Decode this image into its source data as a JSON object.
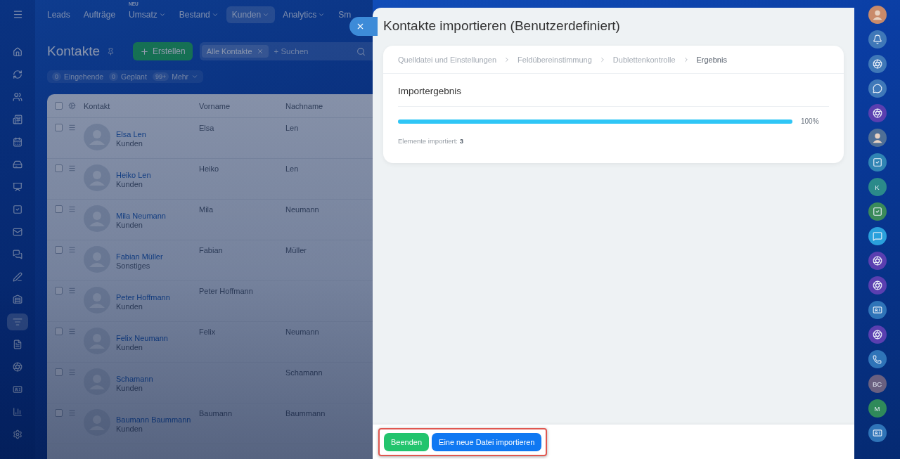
{
  "left_rail": {
    "menu": true,
    "items": [
      {
        "kind": "home",
        "selected": false
      },
      {
        "kind": "loop",
        "selected": false
      },
      {
        "kind": "users",
        "selected": false
      },
      {
        "kind": "news",
        "selected": false
      },
      {
        "kind": "calendar",
        "selected": false
      },
      {
        "kind": "storage",
        "selected": false
      },
      {
        "kind": "board",
        "selected": false
      },
      {
        "kind": "task",
        "selected": false
      },
      {
        "kind": "mail",
        "selected": false
      },
      {
        "kind": "chats",
        "selected": false
      },
      {
        "kind": "pen",
        "selected": false
      },
      {
        "kind": "warehouse",
        "selected": false
      },
      {
        "kind": "filter",
        "selected": true
      },
      {
        "kind": "file",
        "selected": false
      },
      {
        "kind": "aperture",
        "selected": false
      },
      {
        "kind": "card",
        "selected": false
      },
      {
        "kind": "chart",
        "selected": false
      },
      {
        "kind": "settings",
        "selected": false
      }
    ]
  },
  "top_nav": [
    {
      "label": "Leads",
      "selected": false,
      "has_menu": false
    },
    {
      "label": "Aufträge",
      "selected": false,
      "has_menu": false
    },
    {
      "label": "Umsatz",
      "badge": "NEU",
      "selected": false,
      "has_menu": true
    },
    {
      "label": "Bestand",
      "selected": false,
      "has_menu": true
    },
    {
      "label": "Kunden",
      "selected": true,
      "has_menu": true
    },
    {
      "label": "Analytics",
      "selected": false,
      "has_menu": true
    },
    {
      "label": "Sm",
      "selected": false,
      "has_menu": false
    }
  ],
  "page": {
    "title": "Kontakte",
    "create_button": "Erstellen",
    "search": {
      "chip": "Alle Kontakte",
      "placeholder": "+ Suchen"
    },
    "counters": [
      {
        "count": "0",
        "label": "Eingehende",
        "has_menu": false
      },
      {
        "count": "0",
        "label": "Geplant",
        "has_menu": false
      },
      {
        "count": "99+",
        "label": "Mehr",
        "has_menu": true
      }
    ]
  },
  "table": {
    "all_checked": false,
    "columns": [
      "Kontakt",
      "Vorname",
      "Nachname"
    ],
    "rows": [
      {
        "checked": false,
        "name": "Elsa Len",
        "type": "Kunden",
        "first": "Elsa",
        "last": "Len"
      },
      {
        "checked": false,
        "name": "Heiko Len",
        "type": "Kunden",
        "first": "Heiko",
        "last": "Len"
      },
      {
        "checked": false,
        "name": "Mila Neumann",
        "type": "Kunden",
        "first": "Mila",
        "last": "Neumann"
      },
      {
        "checked": false,
        "name": "Fabian Müller",
        "type": "Sonstiges",
        "first": "Fabian",
        "last": "Müller"
      },
      {
        "checked": false,
        "name": "Peter Hoffmann",
        "type": "Kunden",
        "first": "Peter Hoffmann"
      },
      {
        "checked": false,
        "name": "Felix Neumann",
        "type": "Kunden",
        "first": "Felix",
        "last": "Neumann"
      },
      {
        "checked": false,
        "name": "Schamann",
        "type": "Kunden",
        "last": "Schamann"
      },
      {
        "checked": false,
        "name": "Baumann Baummann",
        "type": "Kunden",
        "first": "Baumann",
        "last": "Baummann"
      }
    ]
  },
  "slider": {
    "title": "Kontakte importieren (Benutzerdefiniert)",
    "steps": [
      {
        "label": "Quelldatei und Einstellungen",
        "selected": false
      },
      {
        "label": "Feldübereinstimmung",
        "selected": false
      },
      {
        "label": "Dublettenkontrolle",
        "selected": false
      },
      {
        "label": "Ergebnis",
        "selected": true
      }
    ],
    "section_title": "Importergebnis",
    "progress": {
      "level": 1,
      "reading": "100%"
    },
    "summary": "Elemente importiert: **3**",
    "footer": {
      "highlighted": true,
      "buttons": [
        {
          "label": "Beenden",
          "kind": "finish"
        },
        {
          "label": "Eine neue Datei importieren",
          "kind": "primary"
        }
      ]
    }
  },
  "right_bar": [
    {
      "kind": "avatar",
      "color": "#c98a6a"
    },
    {
      "kind": "bell",
      "color": "#3f78b8"
    },
    {
      "kind": "copilot",
      "color": "#3f78b8"
    },
    {
      "kind": "chat",
      "color": "#3f78b8"
    },
    {
      "kind": "copilot",
      "color": "#5a3fb0"
    },
    {
      "kind": "avatar",
      "color": "#4f6f96"
    },
    {
      "kind": "task",
      "color": "#2f84b3"
    },
    {
      "kind": "letter",
      "label": "K",
      "color": "#2b8a8a"
    },
    {
      "kind": "task",
      "color": "#3a8a5a"
    },
    {
      "kind": "message",
      "color": "#2aa0dc"
    },
    {
      "kind": "copilot",
      "color": "#5a3fb0"
    },
    {
      "kind": "copilot",
      "color": "#5a3fb0"
    },
    {
      "kind": "card",
      "color": "#2f74b8"
    },
    {
      "kind": "copilot",
      "color": "#5a3fb0"
    },
    {
      "kind": "phone",
      "color": "#2f74b8"
    },
    {
      "kind": "letter",
      "label": "BC",
      "color": "#6a6080"
    },
    {
      "kind": "letter",
      "label": "M",
      "color": "#2f8a5a"
    },
    {
      "kind": "card",
      "color": "#2f74b8"
    }
  ]
}
